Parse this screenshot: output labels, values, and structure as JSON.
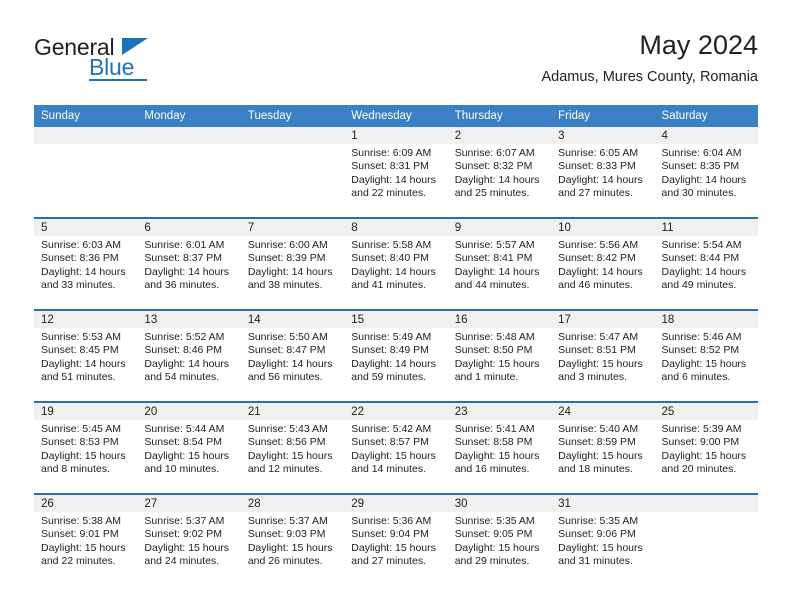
{
  "brand": {
    "name_top": "General",
    "name_bottom": "Blue",
    "accent_color": "#1b72b8",
    "logo_icon": "triangle-flag-icon"
  },
  "header": {
    "title": "May 2024",
    "subtitle": "Adamus, Mures County, Romania"
  },
  "theme": {
    "header_row_bg": "#3b7fc4",
    "row_divider": "#2a6fb5",
    "daynum_bg": "#f0f0f0",
    "text": "#222222"
  },
  "weekdays": [
    "Sunday",
    "Monday",
    "Tuesday",
    "Wednesday",
    "Thursday",
    "Friday",
    "Saturday"
  ],
  "labels": {
    "sunrise_prefix": "Sunrise:",
    "sunset_prefix": "Sunset:",
    "daylight_prefix": "Daylight:"
  },
  "weeks": [
    [
      {
        "empty": true
      },
      {
        "empty": true
      },
      {
        "empty": true
      },
      {
        "day": "1",
        "l1": "Sunrise: 6:09 AM",
        "l2": "Sunset: 8:31 PM",
        "l3": "Daylight: 14 hours and 22 minutes."
      },
      {
        "day": "2",
        "l1": "Sunrise: 6:07 AM",
        "l2": "Sunset: 8:32 PM",
        "l3": "Daylight: 14 hours and 25 minutes."
      },
      {
        "day": "3",
        "l1": "Sunrise: 6:05 AM",
        "l2": "Sunset: 8:33 PM",
        "l3": "Daylight: 14 hours and 27 minutes."
      },
      {
        "day": "4",
        "l1": "Sunrise: 6:04 AM",
        "l2": "Sunset: 8:35 PM",
        "l3": "Daylight: 14 hours and 30 minutes."
      }
    ],
    [
      {
        "day": "5",
        "l1": "Sunrise: 6:03 AM",
        "l2": "Sunset: 8:36 PM",
        "l3": "Daylight: 14 hours and 33 minutes."
      },
      {
        "day": "6",
        "l1": "Sunrise: 6:01 AM",
        "l2": "Sunset: 8:37 PM",
        "l3": "Daylight: 14 hours and 36 minutes."
      },
      {
        "day": "7",
        "l1": "Sunrise: 6:00 AM",
        "l2": "Sunset: 8:39 PM",
        "l3": "Daylight: 14 hours and 38 minutes."
      },
      {
        "day": "8",
        "l1": "Sunrise: 5:58 AM",
        "l2": "Sunset: 8:40 PM",
        "l3": "Daylight: 14 hours and 41 minutes."
      },
      {
        "day": "9",
        "l1": "Sunrise: 5:57 AM",
        "l2": "Sunset: 8:41 PM",
        "l3": "Daylight: 14 hours and 44 minutes."
      },
      {
        "day": "10",
        "l1": "Sunrise: 5:56 AM",
        "l2": "Sunset: 8:42 PM",
        "l3": "Daylight: 14 hours and 46 minutes."
      },
      {
        "day": "11",
        "l1": "Sunrise: 5:54 AM",
        "l2": "Sunset: 8:44 PM",
        "l3": "Daylight: 14 hours and 49 minutes."
      }
    ],
    [
      {
        "day": "12",
        "l1": "Sunrise: 5:53 AM",
        "l2": "Sunset: 8:45 PM",
        "l3": "Daylight: 14 hours and 51 minutes."
      },
      {
        "day": "13",
        "l1": "Sunrise: 5:52 AM",
        "l2": "Sunset: 8:46 PM",
        "l3": "Daylight: 14 hours and 54 minutes."
      },
      {
        "day": "14",
        "l1": "Sunrise: 5:50 AM",
        "l2": "Sunset: 8:47 PM",
        "l3": "Daylight: 14 hours and 56 minutes."
      },
      {
        "day": "15",
        "l1": "Sunrise: 5:49 AM",
        "l2": "Sunset: 8:49 PM",
        "l3": "Daylight: 14 hours and 59 minutes."
      },
      {
        "day": "16",
        "l1": "Sunrise: 5:48 AM",
        "l2": "Sunset: 8:50 PM",
        "l3": "Daylight: 15 hours and 1 minute."
      },
      {
        "day": "17",
        "l1": "Sunrise: 5:47 AM",
        "l2": "Sunset: 8:51 PM",
        "l3": "Daylight: 15 hours and 3 minutes."
      },
      {
        "day": "18",
        "l1": "Sunrise: 5:46 AM",
        "l2": "Sunset: 8:52 PM",
        "l3": "Daylight: 15 hours and 6 minutes."
      }
    ],
    [
      {
        "day": "19",
        "l1": "Sunrise: 5:45 AM",
        "l2": "Sunset: 8:53 PM",
        "l3": "Daylight: 15 hours and 8 minutes."
      },
      {
        "day": "20",
        "l1": "Sunrise: 5:44 AM",
        "l2": "Sunset: 8:54 PM",
        "l3": "Daylight: 15 hours and 10 minutes."
      },
      {
        "day": "21",
        "l1": "Sunrise: 5:43 AM",
        "l2": "Sunset: 8:56 PM",
        "l3": "Daylight: 15 hours and 12 minutes."
      },
      {
        "day": "22",
        "l1": "Sunrise: 5:42 AM",
        "l2": "Sunset: 8:57 PM",
        "l3": "Daylight: 15 hours and 14 minutes."
      },
      {
        "day": "23",
        "l1": "Sunrise: 5:41 AM",
        "l2": "Sunset: 8:58 PM",
        "l3": "Daylight: 15 hours and 16 minutes."
      },
      {
        "day": "24",
        "l1": "Sunrise: 5:40 AM",
        "l2": "Sunset: 8:59 PM",
        "l3": "Daylight: 15 hours and 18 minutes."
      },
      {
        "day": "25",
        "l1": "Sunrise: 5:39 AM",
        "l2": "Sunset: 9:00 PM",
        "l3": "Daylight: 15 hours and 20 minutes."
      }
    ],
    [
      {
        "day": "26",
        "l1": "Sunrise: 5:38 AM",
        "l2": "Sunset: 9:01 PM",
        "l3": "Daylight: 15 hours and 22 minutes."
      },
      {
        "day": "27",
        "l1": "Sunrise: 5:37 AM",
        "l2": "Sunset: 9:02 PM",
        "l3": "Daylight: 15 hours and 24 minutes."
      },
      {
        "day": "28",
        "l1": "Sunrise: 5:37 AM",
        "l2": "Sunset: 9:03 PM",
        "l3": "Daylight: 15 hours and 26 minutes."
      },
      {
        "day": "29",
        "l1": "Sunrise: 5:36 AM",
        "l2": "Sunset: 9:04 PM",
        "l3": "Daylight: 15 hours and 27 minutes."
      },
      {
        "day": "30",
        "l1": "Sunrise: 5:35 AM",
        "l2": "Sunset: 9:05 PM",
        "l3": "Daylight: 15 hours and 29 minutes."
      },
      {
        "day": "31",
        "l1": "Sunrise: 5:35 AM",
        "l2": "Sunset: 9:06 PM",
        "l3": "Daylight: 15 hours and 31 minutes."
      },
      {
        "empty": true
      }
    ]
  ]
}
